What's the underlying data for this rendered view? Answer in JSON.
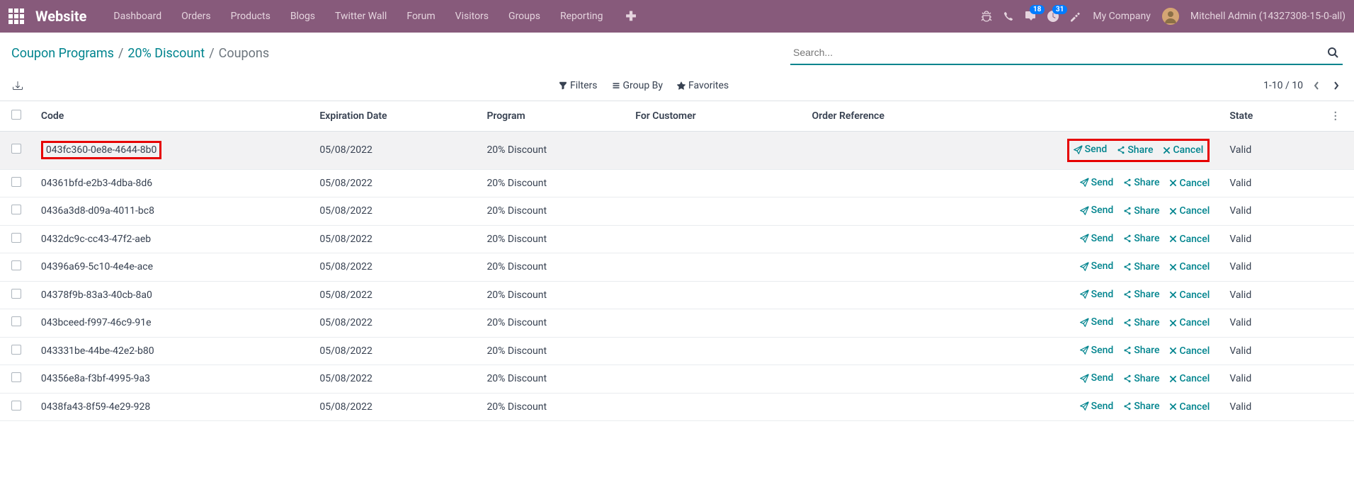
{
  "brand": "Website",
  "nav": [
    "Dashboard",
    "Orders",
    "Products",
    "Blogs",
    "Twitter Wall",
    "Forum",
    "Visitors",
    "Groups",
    "Reporting"
  ],
  "messaging_badge": "18",
  "activity_badge": "31",
  "company": "My Company",
  "user": "Mitchell Admin (14327308-15-0-all)",
  "breadcrumb": {
    "parent1": "Coupon Programs",
    "parent2": "20% Discount",
    "current": "Coupons"
  },
  "search_placeholder": "Search...",
  "filters_label": "Filters",
  "groupby_label": "Group By",
  "favorites_label": "Favorites",
  "pager_text": "1-10 / 10",
  "columns": {
    "code": "Code",
    "exp": "Expiration Date",
    "program": "Program",
    "customer": "For Customer",
    "order": "Order Reference",
    "state": "State"
  },
  "actions": {
    "send": "Send",
    "share": "Share",
    "cancel": "Cancel"
  },
  "rows": [
    {
      "code": "043fc360-0e8e-4644-8b0",
      "exp": "05/08/2022",
      "program": "20% Discount",
      "state": "Valid",
      "highlight": true
    },
    {
      "code": "04361bfd-e2b3-4dba-8d6",
      "exp": "05/08/2022",
      "program": "20% Discount",
      "state": "Valid"
    },
    {
      "code": "0436a3d8-d09a-4011-bc8",
      "exp": "05/08/2022",
      "program": "20% Discount",
      "state": "Valid"
    },
    {
      "code": "0432dc9c-cc43-47f2-aeb",
      "exp": "05/08/2022",
      "program": "20% Discount",
      "state": "Valid"
    },
    {
      "code": "04396a69-5c10-4e4e-ace",
      "exp": "05/08/2022",
      "program": "20% Discount",
      "state": "Valid"
    },
    {
      "code": "04378f9b-83a3-40cb-8a0",
      "exp": "05/08/2022",
      "program": "20% Discount",
      "state": "Valid"
    },
    {
      "code": "043bceed-f997-46c9-91e",
      "exp": "05/08/2022",
      "program": "20% Discount",
      "state": "Valid"
    },
    {
      "code": "043331be-44be-42e2-b80",
      "exp": "05/08/2022",
      "program": "20% Discount",
      "state": "Valid"
    },
    {
      "code": "04356e8a-f3bf-4995-9a3",
      "exp": "05/08/2022",
      "program": "20% Discount",
      "state": "Valid"
    },
    {
      "code": "0438fa43-8f59-4e29-928",
      "exp": "05/08/2022",
      "program": "20% Discount",
      "state": "Valid"
    }
  ]
}
